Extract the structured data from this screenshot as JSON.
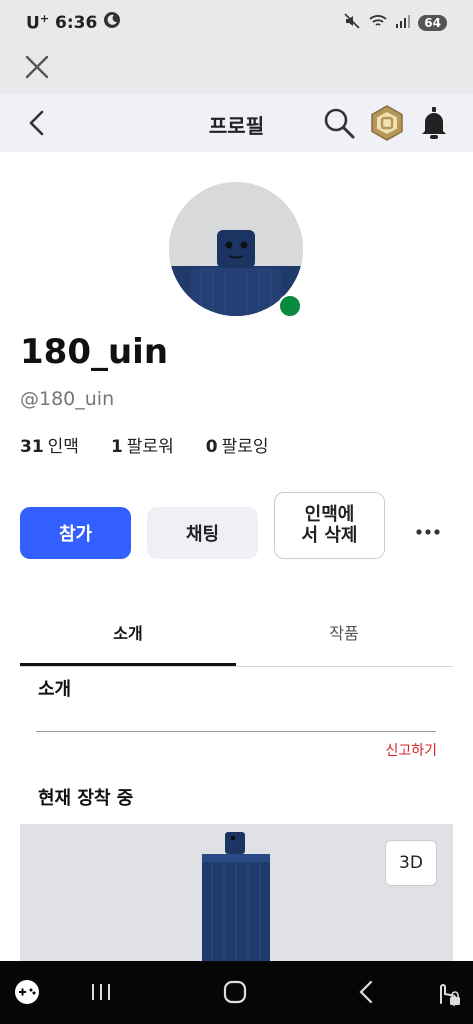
{
  "status_bar": {
    "carrier": "U",
    "carrier_sup": "+",
    "time": "6:36",
    "battery": "64"
  },
  "header": {
    "title": "프로필"
  },
  "profile": {
    "username": "180_uin",
    "handle": "@180_uin",
    "stats": [
      {
        "count": "31",
        "label": "인맥"
      },
      {
        "count": "1",
        "label": "팔로워"
      },
      {
        "count": "0",
        "label": "팔로잉"
      }
    ],
    "online": true
  },
  "actions": {
    "join": "참가",
    "chat": "채팅",
    "remove_line1": "인맥에",
    "remove_line2": "서 삭제"
  },
  "tabs": {
    "about": "소개",
    "creations": "작품",
    "active": "about"
  },
  "about": {
    "title": "소개",
    "report": "신고하기"
  },
  "wearing": {
    "title": "현재 장착 중",
    "view_3d": "3D"
  },
  "colors": {
    "primary": "#335fff",
    "online": "#0a8a3f",
    "report": "#dd2222",
    "avatar_body": "#1f3a6b"
  }
}
